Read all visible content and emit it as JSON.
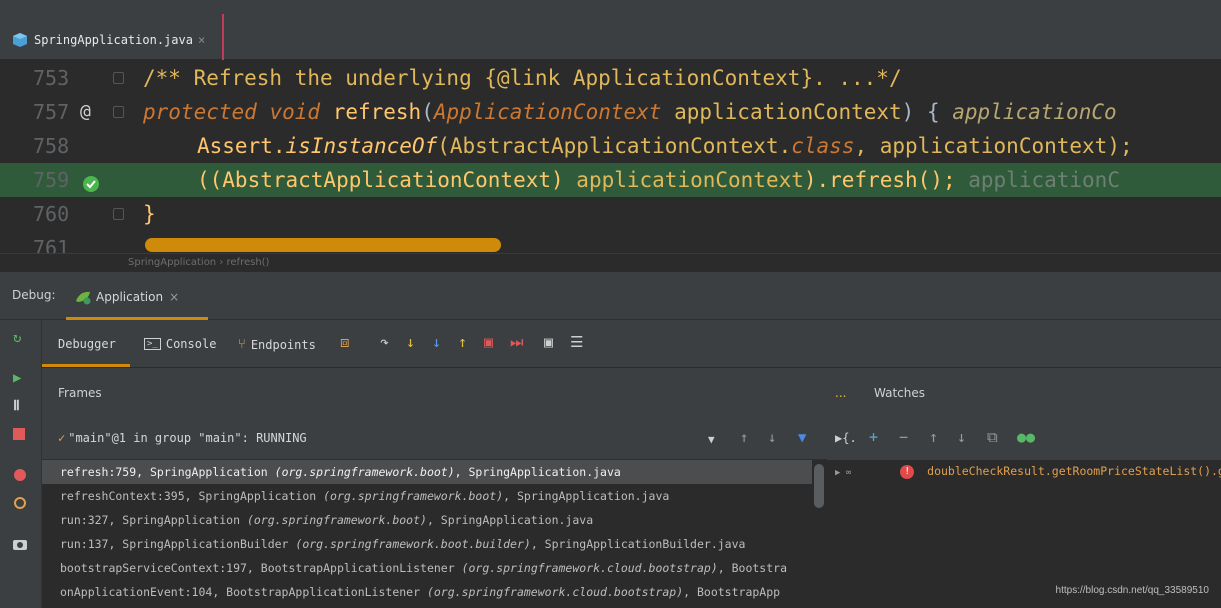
{
  "editor_tab": {
    "filename": "SpringApplication.java",
    "close": "×"
  },
  "code_lines": [
    {
      "num": "753",
      "text": "/** Refresh the underlying {@link ApplicationContext}. ...*/"
    },
    {
      "num": "757",
      "marker": "@",
      "kw1": "protected",
      "kw2": "void",
      "method": "refresh",
      "open": "(",
      "param_type": "ApplicationContext",
      "param": "applicationContext",
      "close": ") {",
      "hint": "applicationCo"
    },
    {
      "num": "758",
      "prefix": "Assert.",
      "method": "isInstanceOf",
      "args1": "(AbstractApplicationContext.",
      "kw": "class",
      "args2": ", applicationContext);"
    },
    {
      "num": "759",
      "cast": "((AbstractApplicationContext) ",
      "var": "applicationContext",
      "call": ").refresh();",
      "hint": "applicationC"
    },
    {
      "num": "760",
      "text": "}"
    },
    {
      "num": "761"
    }
  ],
  "breadcrumb": "SpringApplication  ›  refresh()",
  "debug": {
    "label": "Debug:",
    "session_tab": "Application",
    "close": "×"
  },
  "subtabs": {
    "debugger": "Debugger",
    "console": "Console",
    "endpoints": "Endpoints"
  },
  "frames": {
    "header": "Frames",
    "thread": "\"main\"@1 in group \"main\": RUNNING",
    "items": [
      {
        "method": "refresh:759, SpringApplication ",
        "pkg": "(org.springframework.boot)",
        "file": ", SpringApplication.java"
      },
      {
        "method": "refreshContext:395, SpringApplication ",
        "pkg": "(org.springframework.boot)",
        "file": ", SpringApplication.java"
      },
      {
        "method": "run:327, SpringApplication ",
        "pkg": "(org.springframework.boot)",
        "file": ", SpringApplication.java"
      },
      {
        "method": "run:137, SpringApplicationBuilder ",
        "pkg": "(org.springframework.boot.builder)",
        "file": ", SpringApplicationBuilder.java"
      },
      {
        "method": "bootstrapServiceContext:197, BootstrapApplicationListener ",
        "pkg": "(org.springframework.cloud.bootstrap)",
        "file": ", Bootstra"
      },
      {
        "method": "onApplicationEvent:104, BootstrapApplicationListener ",
        "pkg": "(org.springframework.cloud.bootstrap)",
        "file": ", BootstrapApp"
      }
    ]
  },
  "watches": {
    "dots": "...",
    "header": "Watches",
    "row_prefix": "▶ ∞",
    "item": "doubleCheckResult.getRoomPriceStateList().g"
  },
  "watermark": "https://blog.csdn.net/qq_33589510"
}
